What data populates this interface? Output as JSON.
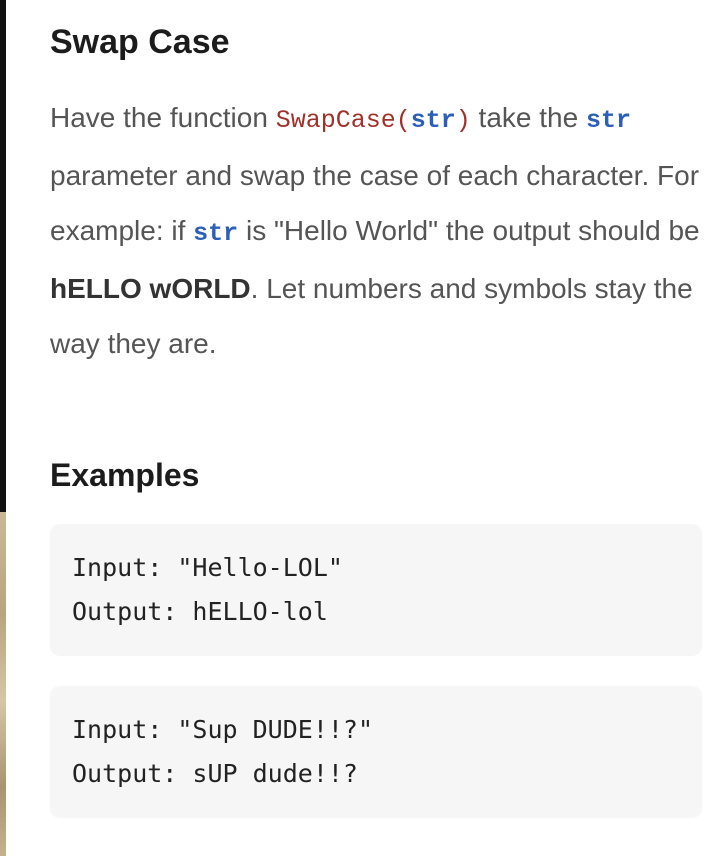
{
  "problem": {
    "title": "Swap Case",
    "description": {
      "t1": "Have the function ",
      "fn_name": "SwapCase",
      "fn_open": "(",
      "fn_param": "str",
      "fn_close": ")",
      "t2": " take the ",
      "param1": "str",
      "t3": " parameter and swap the case of each character. For example: if ",
      "param2": "str",
      "t4": " is \"Hello World\" the output should be ",
      "sample_output": "hELLO wORLD",
      "t5": ". Let numbers and symbols stay the way they are."
    }
  },
  "examples": {
    "heading": "Examples",
    "items": [
      {
        "input_line": "Input: \"Hello-LOL\"",
        "output_line": "Output: hELLO-lol"
      },
      {
        "input_line": "Input: \"Sup DUDE!!?\"",
        "output_line": "Output: sUP dude!!?"
      }
    ]
  },
  "colors": {
    "function_name": "#a0302a",
    "parameter": "#2c5fb8",
    "body_text": "#555555",
    "code_block_bg": "#f6f6f6"
  }
}
